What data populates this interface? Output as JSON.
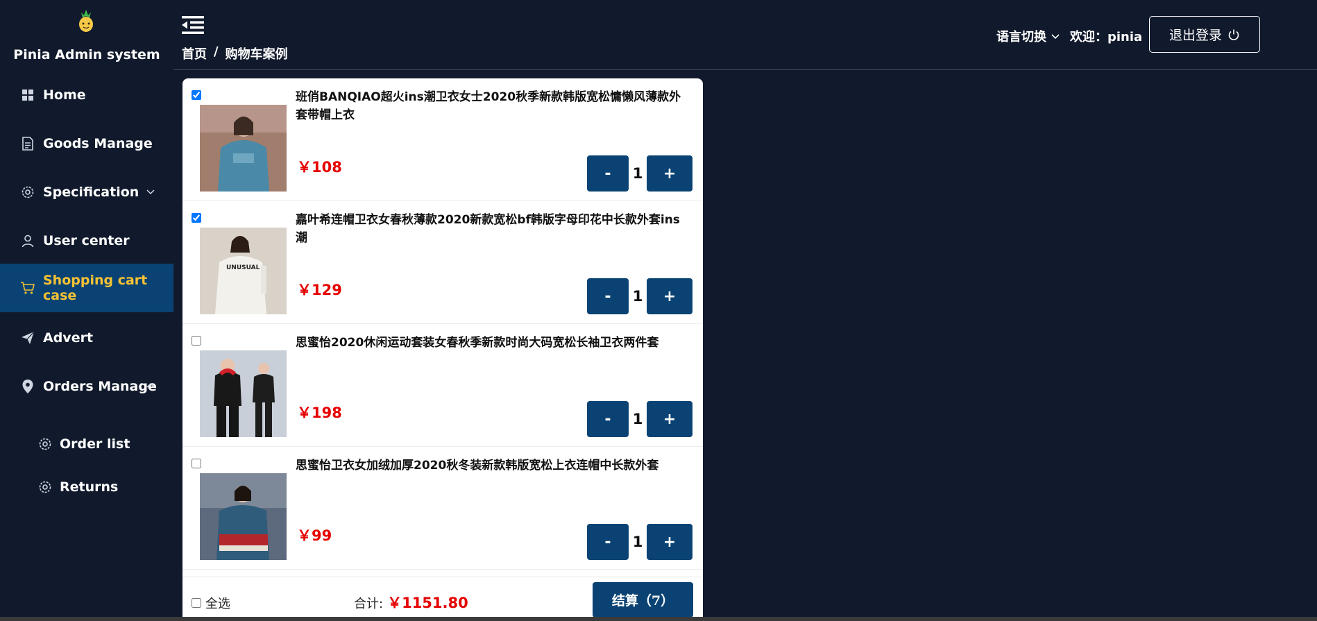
{
  "sidebar": {
    "brand_title": "Pinia Admin system",
    "logo_icon": "pineapple-icon",
    "items": [
      {
        "label": "Home",
        "icon": "grid-icon"
      },
      {
        "label": "Goods Manage",
        "icon": "document-icon"
      },
      {
        "label": "Specification",
        "icon": "gear-icon",
        "expandable": "chevron-down"
      },
      {
        "label": "User center",
        "icon": "user-icon"
      },
      {
        "label": "Shopping cart case",
        "icon": "cart-icon",
        "active": true
      },
      {
        "label": "Advert",
        "icon": "paper-plane-icon"
      },
      {
        "label": "Orders Manage",
        "icon": "location-pin-icon",
        "expandable": "chevron-up"
      }
    ],
    "subitems": [
      {
        "label": "Order list",
        "icon": "gear-icon"
      },
      {
        "label": "Returns",
        "icon": "gear-icon"
      }
    ]
  },
  "header": {
    "breadcrumb": [
      "首页",
      "/",
      "购物车案例"
    ],
    "lang_switch": "语言切换",
    "welcome": "欢迎：pinia",
    "logout": "退出登录"
  },
  "cart": {
    "items": [
      {
        "title": "班俏BANQIAO超火ins潮卫衣女士2020秋季新款韩版宽松慵懒风薄款外套带帽上衣",
        "price": "￥108",
        "qty": "1",
        "checked": true,
        "minus": "-",
        "plus": "+"
      },
      {
        "title": "嘉叶希连帽卫衣女春秋薄款2020新款宽松bf韩版字母印花中长款外套ins潮",
        "price": "￥129",
        "qty": "1",
        "checked": true,
        "minus": "-",
        "plus": "+"
      },
      {
        "title": "思蜜怡2020休闲运动套装女春秋季新款时尚大码宽松长袖卫衣两件套",
        "price": "￥198",
        "qty": "1",
        "checked": false,
        "minus": "-",
        "plus": "+"
      },
      {
        "title": "思蜜怡卫衣女加绒加厚2020秋冬装新款韩版宽松上衣连帽中长款外套",
        "price": "￥99",
        "qty": "1",
        "checked": false,
        "minus": "-",
        "plus": "+"
      }
    ],
    "footer": {
      "select_all": "全选",
      "total_label": "合计:",
      "total_value": "￥1151.80",
      "checkout": "结算（7）"
    }
  },
  "colors": {
    "background": "#111a2c",
    "active_menu_bg": "#0a4373",
    "active_menu_text": "#f6c233",
    "button": "#0a4373",
    "price": "#e60000"
  }
}
